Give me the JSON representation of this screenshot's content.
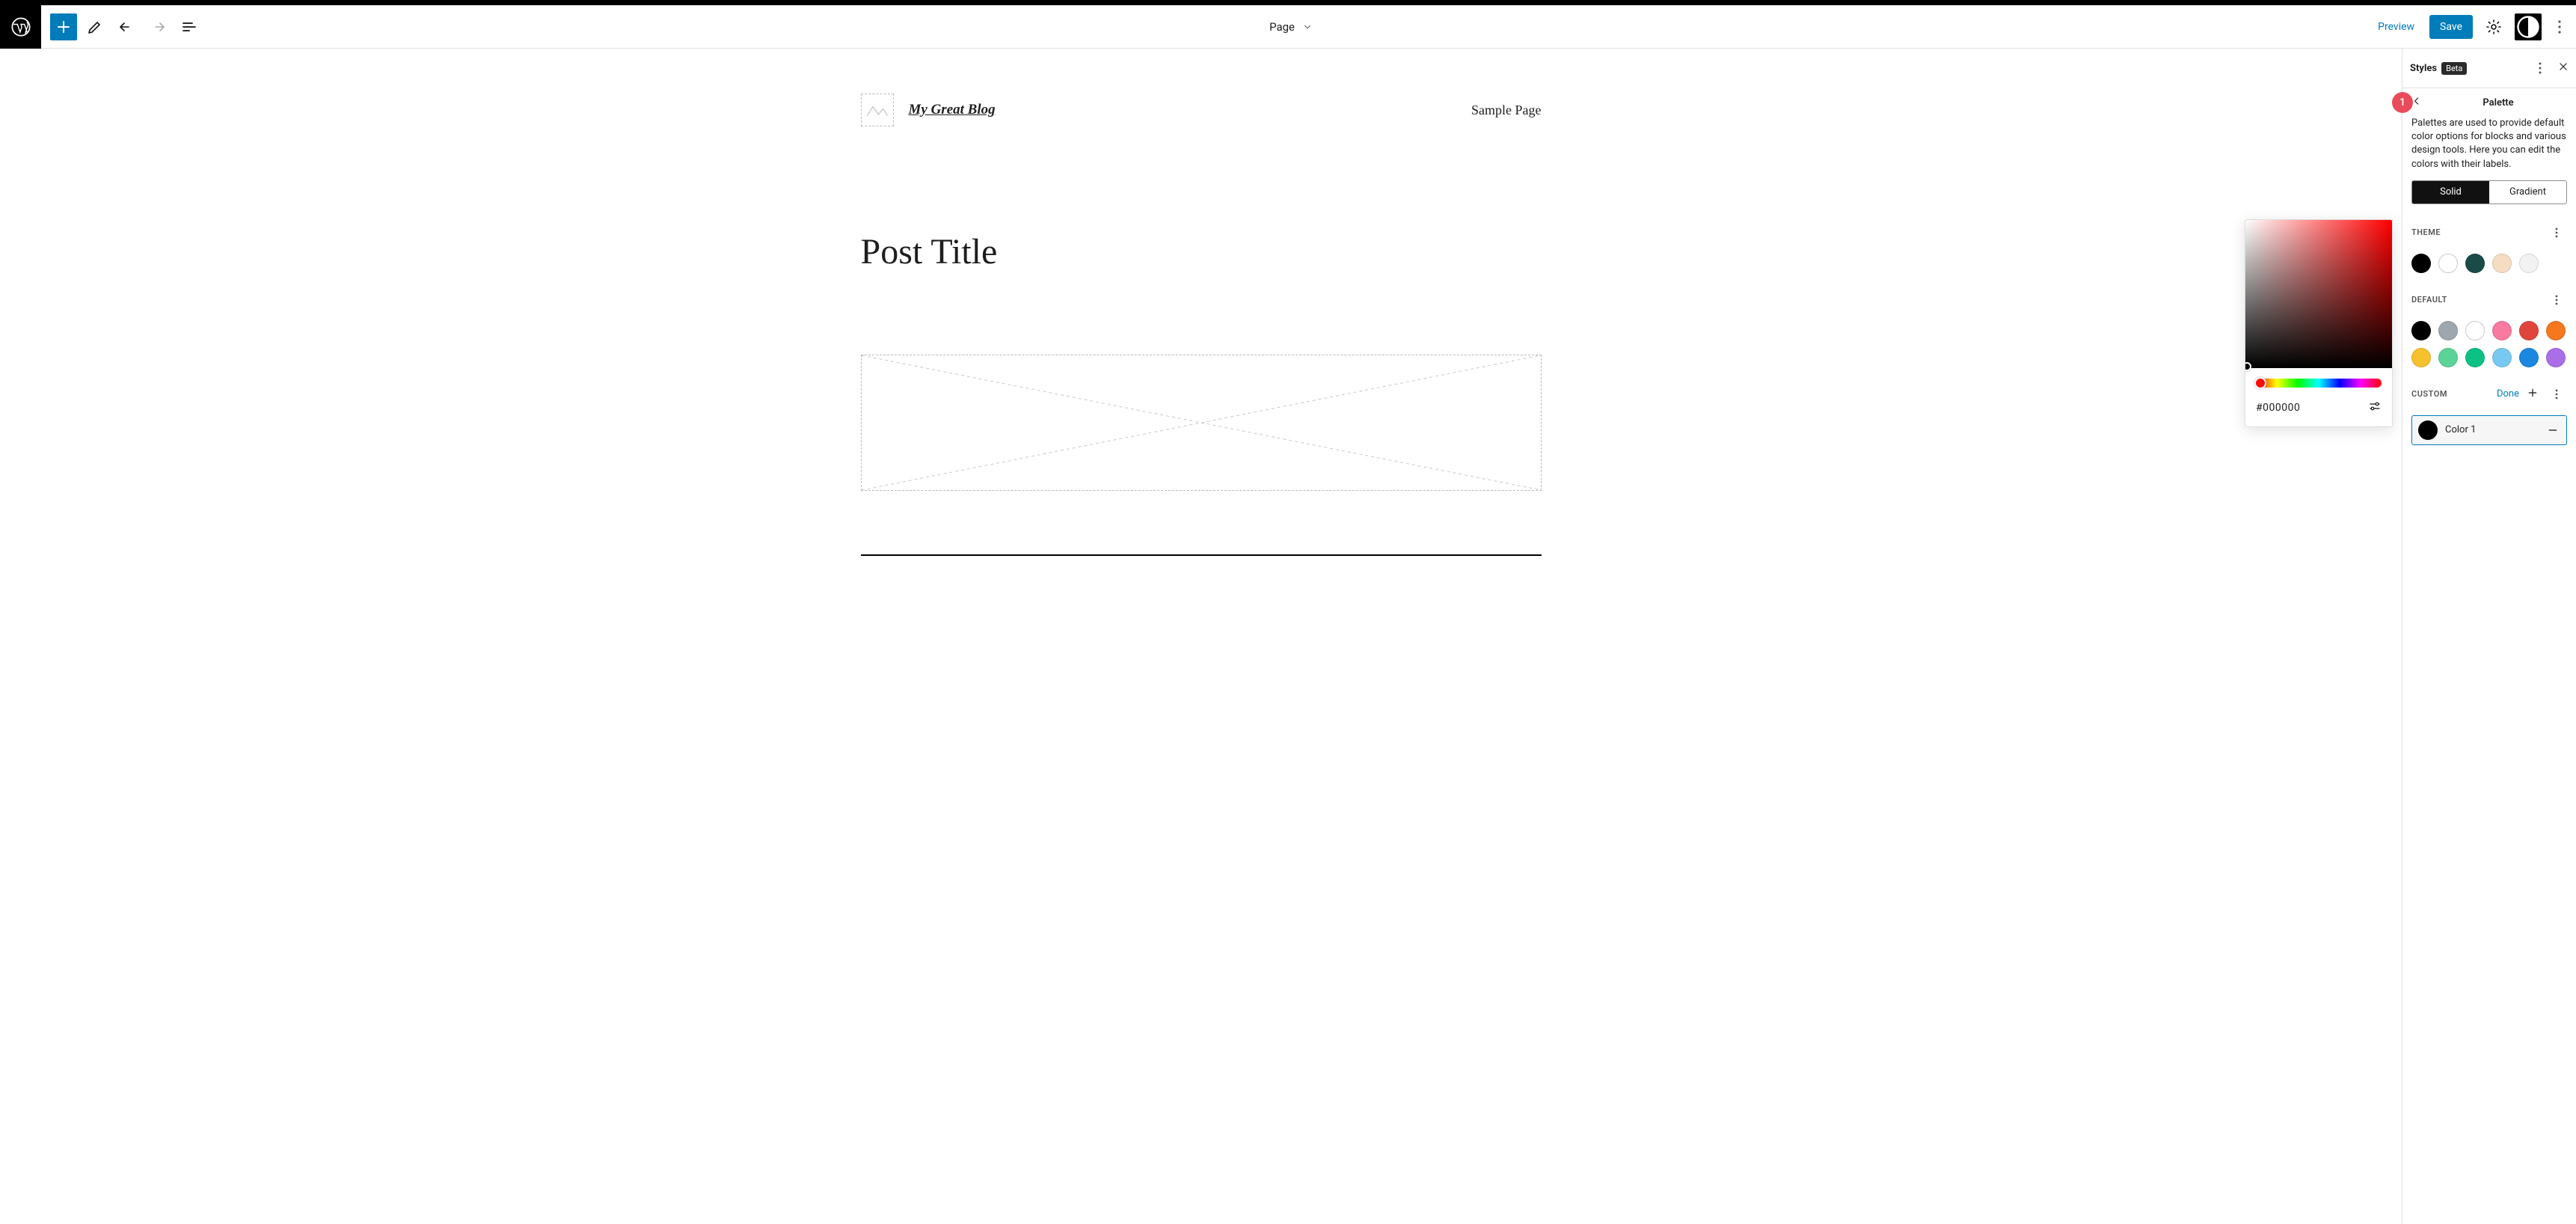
{
  "topbar": {
    "doc_type": "Page",
    "preview": "Preview",
    "save": "Save"
  },
  "site": {
    "title": "My Great Blog",
    "nav_item": "Sample Page",
    "post_title": "Post Title"
  },
  "picker": {
    "hex": "#000000"
  },
  "panel": {
    "title": "Styles",
    "badge": "Beta",
    "crumb": "Palette",
    "callout": "1",
    "help": "Palettes are used to provide default color options for blocks and various design tools. Here you can edit the colors with their labels.",
    "tabs": {
      "solid": "Solid",
      "gradient": "Gradient"
    },
    "theme": {
      "label": "THEME",
      "swatches": [
        "#000000",
        "#ffffff",
        "#1b4b47",
        "#f7dcc4",
        "#f2f2f2"
      ]
    },
    "default": {
      "label": "DEFAULT",
      "swatches": [
        "#000000",
        "#9da7af",
        "#ffffff",
        "#f87aa0",
        "#e0453b",
        "#f5781f",
        "#f6c12e",
        "#5bd397",
        "#0cc184",
        "#78c9f2",
        "#1a88e0",
        "#a96ee8"
      ]
    },
    "custom": {
      "label": "CUSTOM",
      "done": "Done",
      "item_name": "Color 1",
      "item_color": "#000000"
    }
  }
}
